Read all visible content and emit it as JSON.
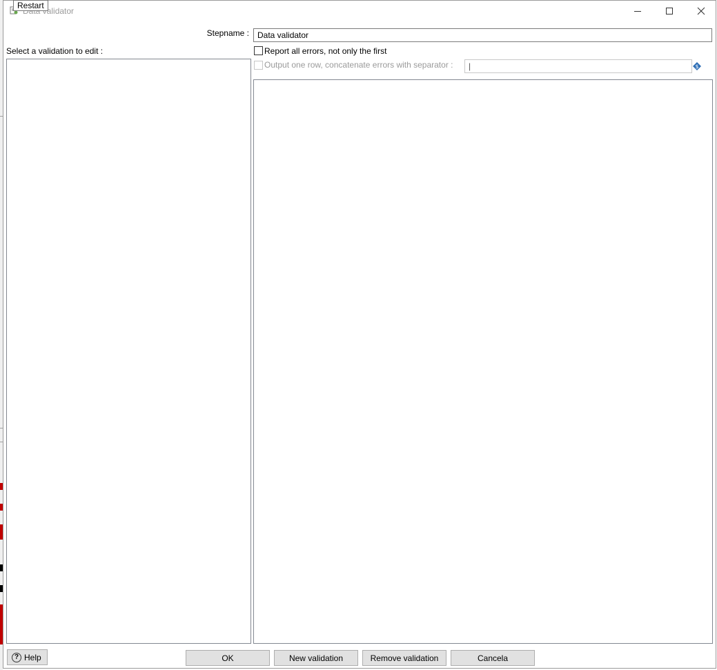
{
  "window": {
    "title": "Data validator",
    "tooltip": "Restart"
  },
  "form": {
    "stepname_label": "Stepname :",
    "stepname_value": "Data validator",
    "select_validation_label": "Select a validation to edit :",
    "report_all_errors_label": "Report all errors, not only the first",
    "report_all_errors_checked": false,
    "output_one_row_label": "Output one row, concatenate errors with separator :",
    "output_one_row_checked": false,
    "separator_value": "|"
  },
  "buttons": {
    "help": "Help",
    "ok": "OK",
    "new_validation": "New validation",
    "remove_validation": "Remove validation",
    "cancel": "Cancela"
  },
  "icons": {
    "app": "data-validator-icon",
    "minimize": "minimize-icon",
    "maximize": "maximize-icon",
    "close": "close-icon",
    "variable": "variable-diamond-icon",
    "help": "help-circle-icon"
  },
  "colors": {
    "dialog_background": "#ffffff",
    "button_face": "#e1e1e1",
    "disabled_text": "#9a9a9a",
    "variable_icon": "#2f6fb5"
  }
}
